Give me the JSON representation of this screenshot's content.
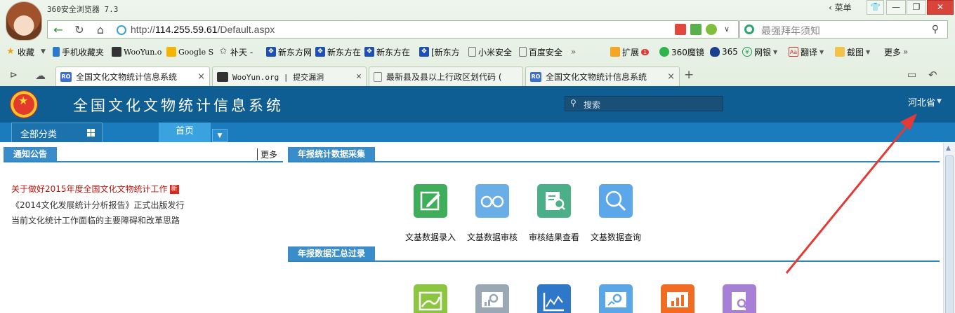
{
  "browser": {
    "app_title": "360安全浏览器 7.3",
    "menu_label": "菜单",
    "window_buttons": [
      "👕",
      "—",
      "❐",
      "✕"
    ],
    "address": {
      "scheme": "http://",
      "host": "114.255.59.61",
      "path": "/Default.aspx"
    },
    "search_placeholder": "最强拜年须知",
    "bookmarks": [
      {
        "label": "收藏",
        "icon": "star-icon"
      },
      {
        "label": "手机收藏夹",
        "icon": "phone-icon"
      },
      {
        "label": "WooYun.o",
        "icon": "wooyun-icon"
      },
      {
        "label": "Google S",
        "icon": "google-icon"
      },
      {
        "label": "补天 -",
        "icon": "butian-icon"
      },
      {
        "label": "新东方网",
        "icon": "paw-icon"
      },
      {
        "label": "新东方在",
        "icon": "paw-icon"
      },
      {
        "label": "新东方在",
        "icon": "paw-icon"
      },
      {
        "label": "[新东方",
        "icon": "paw-icon"
      },
      {
        "label": "小米安全",
        "icon": "page-icon"
      },
      {
        "label": "百度安全",
        "icon": "page-icon"
      }
    ],
    "toolbar_right": [
      {
        "label": "扩展",
        "badge": "1"
      },
      {
        "label": "360魔镜"
      },
      {
        "label": "365"
      },
      {
        "label": "网银"
      },
      {
        "label": "翻译"
      },
      {
        "label": "截图"
      },
      {
        "label": "更多"
      }
    ],
    "tabs": [
      {
        "label": "全国文化文物统计信息系统",
        "icon": "RO",
        "active": true
      },
      {
        "label": "WooYun.org | 提交漏洞",
        "icon": "W"
      },
      {
        "label": "最新县及县以上行政区划代码 (",
        "icon": "page"
      },
      {
        "label": "全国文化文物统计信息系统",
        "icon": "RO"
      }
    ]
  },
  "site": {
    "title": "全国文化文物统计信息系统",
    "search_placeholder": "搜索",
    "province": "河北省",
    "nav": {
      "category_label": "全部分类",
      "home_tab": "首页"
    },
    "notice_panel": {
      "title": "通知公告",
      "more": "更多",
      "items": [
        {
          "text": "关于做好2015年度全国文化文物统计工作",
          "hot": true,
          "badge": "新"
        },
        {
          "text": "《2014文化发展统计分析报告》正式出版发行"
        },
        {
          "text": "当前文化统计工作面临的主要障碍和改革思路"
        }
      ]
    },
    "section1": {
      "title": "年报统计数据采集",
      "tiles": [
        {
          "label": "文基数据录入",
          "color": "#3fae5a",
          "icon": "edit-icon"
        },
        {
          "label": "文基数据审核",
          "color": "#6aaee8",
          "icon": "glasses-icon"
        },
        {
          "label": "审核结果查看",
          "color": "#4bb08a",
          "icon": "report-search-icon"
        },
        {
          "label": "文基数据查询",
          "color": "#5ba7ea",
          "icon": "magnifier-icon"
        }
      ]
    },
    "section2": {
      "title": "年报数据汇总过录",
      "tiles": [
        {
          "color": "#8cc63f",
          "icon": "area-chart-icon"
        },
        {
          "color": "#9aa7b4",
          "icon": "monitor-search-icon"
        },
        {
          "color": "#2f77c9",
          "icon": "line-chart-icon"
        },
        {
          "color": "#5aa6e6",
          "icon": "monitor-analytics-icon"
        },
        {
          "color": "#f26b22",
          "icon": "presentation-chart-icon"
        },
        {
          "color": "#a77fd6",
          "icon": "document-search-icon"
        }
      ]
    }
  },
  "annotation": {
    "color": "#e53935"
  }
}
